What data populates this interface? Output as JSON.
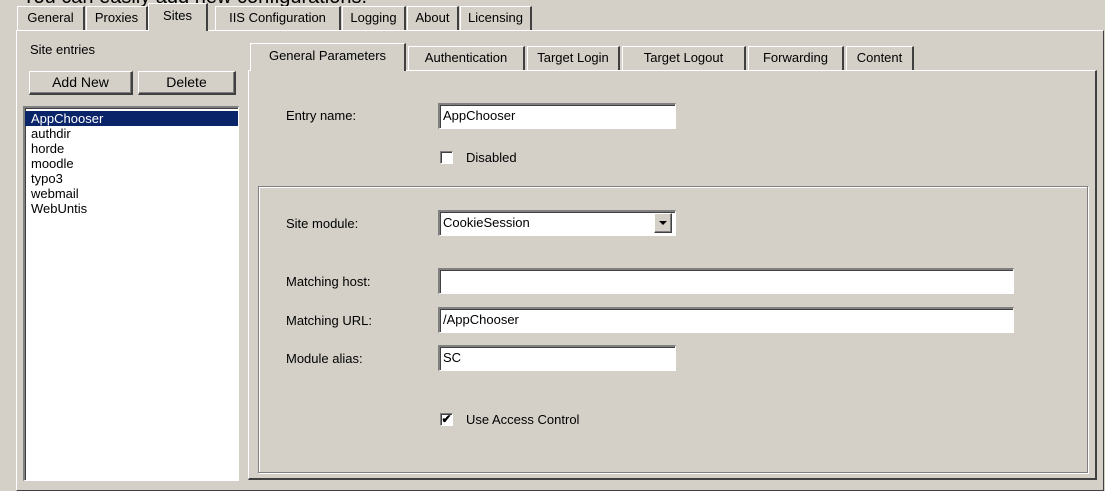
{
  "header": {
    "cutoff_title": "You can easily add new configurations."
  },
  "main_tabs": [
    {
      "label": "General"
    },
    {
      "label": "Proxies"
    },
    {
      "label": "Sites"
    },
    {
      "label": "IIS Configuration"
    },
    {
      "label": "Logging"
    },
    {
      "label": "About"
    },
    {
      "label": "Licensing"
    }
  ],
  "sites": {
    "entries_label": "Site entries",
    "add_button": "Add New",
    "delete_button": "Delete",
    "items": [
      "AppChooser",
      "authdir",
      "horde",
      "moodle",
      "typo3",
      "webmail",
      "WebUntis"
    ],
    "selected": "AppChooser"
  },
  "detail_tabs": [
    {
      "label": "General Parameters"
    },
    {
      "label": "Authentication"
    },
    {
      "label": "Target Login"
    },
    {
      "label": "Target Logout"
    },
    {
      "label": "Forwarding"
    },
    {
      "label": "Content"
    }
  ],
  "form": {
    "entry_name_label": "Entry name:",
    "entry_name_value": "AppChooser",
    "disabled_label": "Disabled",
    "disabled_checked": false,
    "site_module_label": "Site module:",
    "site_module_value": "CookieSession",
    "matching_host_label": "Matching host:",
    "matching_host_value": "",
    "matching_url_label": "Matching URL:",
    "matching_url_value": "/AppChooser",
    "module_alias_label": "Module alias:",
    "module_alias_value": "SC",
    "use_access_control_label": "Use Access Control",
    "use_access_control_checked": true,
    "check_glyph": "✔"
  }
}
